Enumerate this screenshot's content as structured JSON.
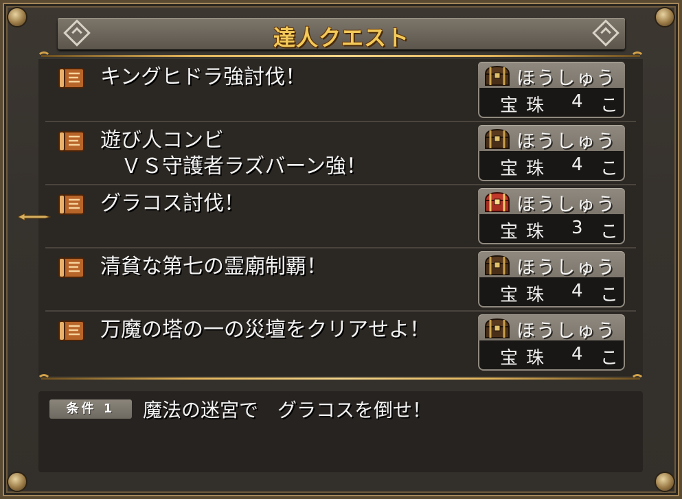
{
  "window": {
    "title": "達人クエスト"
  },
  "quests": [
    {
      "title_line1": "キングヒドラ強討伐！",
      "title_line2": "",
      "reward_label": "ほうしゅう",
      "reward_item": "宝珠",
      "reward_count": "4",
      "reward_unit": "こ",
      "chest": "normal"
    },
    {
      "title_line1": "遊び人コンビ",
      "title_line2": "　ＶＳ守護者ラズバーン強！",
      "reward_label": "ほうしゅう",
      "reward_item": "宝珠",
      "reward_count": "4",
      "reward_unit": "こ",
      "chest": "normal"
    },
    {
      "title_line1": "グラコス討伐！",
      "title_line2": "",
      "reward_label": "ほうしゅう",
      "reward_item": "宝珠",
      "reward_count": "3",
      "reward_unit": "こ",
      "chest": "red"
    },
    {
      "title_line1": "清貧な第七の霊廟制覇！",
      "title_line2": "",
      "reward_label": "ほうしゅう",
      "reward_item": "宝珠",
      "reward_count": "4",
      "reward_unit": "こ",
      "chest": "normal"
    },
    {
      "title_line1": "万魔の塔の一の災壇をクリアせよ！",
      "title_line2": "",
      "reward_label": "ほうしゅう",
      "reward_item": "宝珠",
      "reward_count": "4",
      "reward_unit": "こ",
      "chest": "normal"
    }
  ],
  "selected_index": 2,
  "condition": {
    "badge": "条件 1",
    "text": "魔法の迷宮で　グラコスを倒せ！"
  },
  "colors": {
    "title_gold": "#f3c95a",
    "panel_dark": "#2b2723",
    "frame_bronze": "#a5875a"
  },
  "icons": {
    "quest": "scroll-icon",
    "reward": "treasure-chest-icon",
    "cursor": "pointer-arrow-icon"
  }
}
